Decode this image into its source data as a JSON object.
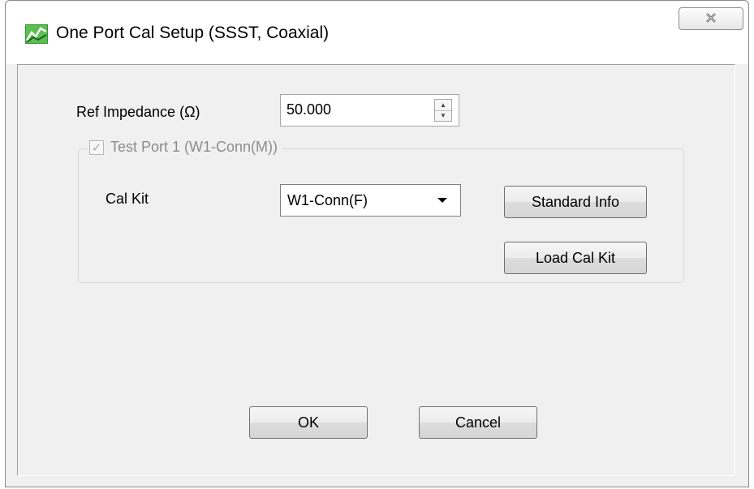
{
  "window": {
    "title": "One Port Cal Setup (SSST, Coaxial)",
    "close_label": "☒"
  },
  "ref_impedance": {
    "label": "Ref Impedance (Ω)",
    "value": "50.000"
  },
  "test_port": {
    "label": "Test Port 1 (W1-Conn(M))",
    "checked": true,
    "enabled": false,
    "cal_kit_label": "Cal Kit",
    "cal_kit_value": "W1-Conn(F)",
    "standard_info_label": "Standard Info",
    "load_cal_kit_label": "Load Cal Kit"
  },
  "footer": {
    "ok_label": "OK",
    "cancel_label": "Cancel"
  },
  "colors": {
    "icon_green": "#3a9a3a",
    "disabled_text": "#8c8c8c"
  }
}
